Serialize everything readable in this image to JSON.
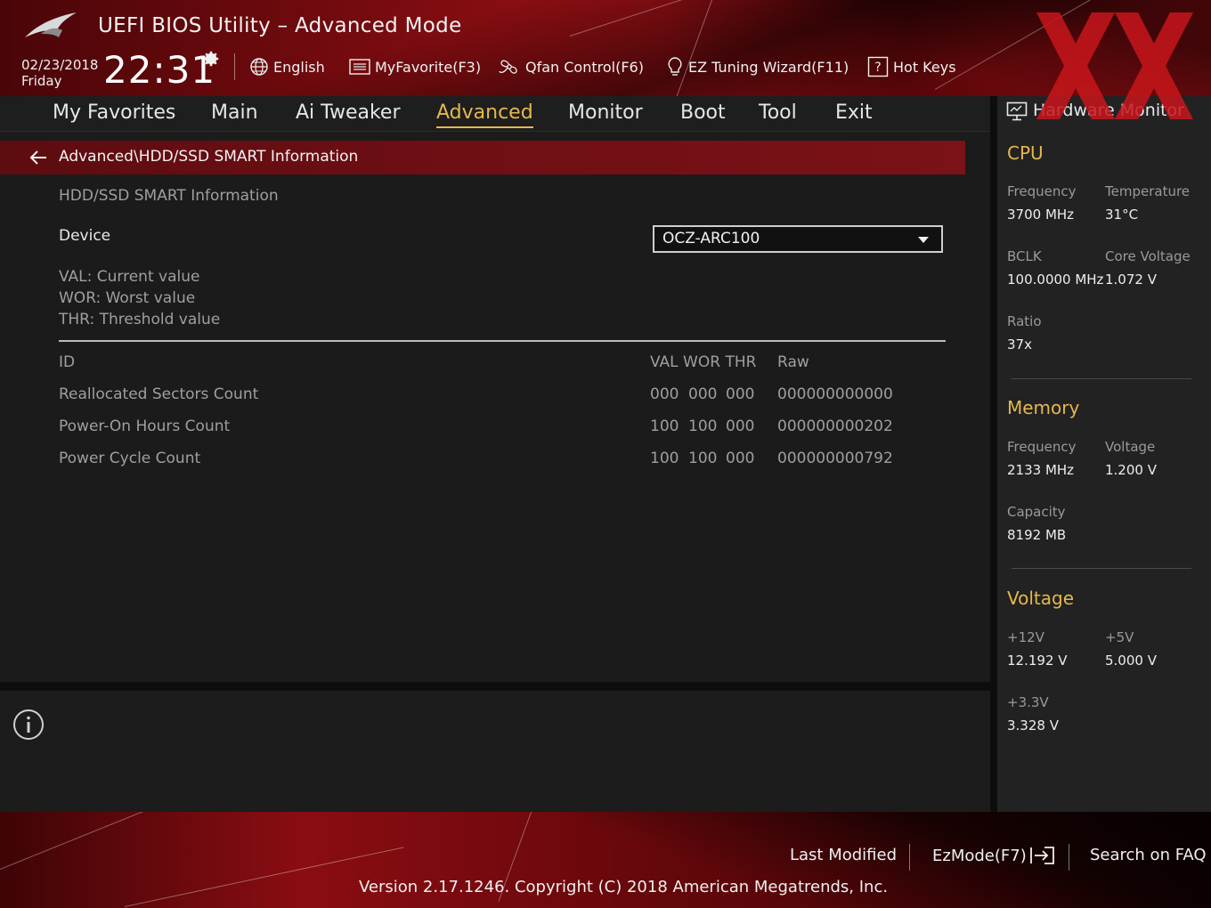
{
  "header": {
    "title": "UEFI BIOS Utility – Advanced Mode",
    "date": "02/23/2018",
    "day": "Friday",
    "time": "22:31",
    "toolbar": {
      "language": "English",
      "myfavorite": "MyFavorite(F3)",
      "qfan": "Qfan Control(F6)",
      "ez_tuning": "EZ Tuning Wizard(F11)",
      "hot_keys": "Hot Keys"
    }
  },
  "nav": {
    "tabs": [
      "My Favorites",
      "Main",
      "Ai Tweaker",
      "Advanced",
      "Monitor",
      "Boot",
      "Tool",
      "Exit"
    ],
    "active": "Advanced"
  },
  "main": {
    "breadcrumb": "Advanced\\HDD/SSD SMART Information",
    "section_heading": "HDD/SSD SMART Information",
    "device_label": "Device",
    "device_value": "OCZ-ARC100",
    "legend": [
      "VAL:  Current value",
      "WOR: Worst value",
      "THR:  Threshold value"
    ],
    "table": {
      "headers": {
        "id": "ID",
        "val_wor_thr": "VAL WOR THR",
        "raw": "Raw"
      },
      "rows": [
        {
          "id": "Reallocated Sectors Count",
          "val": "000",
          "wor": "000",
          "thr": "000",
          "raw": "000000000000"
        },
        {
          "id": "Power-On Hours Count",
          "val": "100",
          "wor": "100",
          "thr": "000",
          "raw": "000000000202"
        },
        {
          "id": "Power Cycle Count",
          "val": "100",
          "wor": "100",
          "thr": "000",
          "raw": "000000000792"
        }
      ]
    }
  },
  "hardware_monitor": {
    "title": "Hardware Monitor",
    "cpu": {
      "heading": "CPU",
      "frequency_label": "Frequency",
      "frequency": "3700 MHz",
      "temperature_label": "Temperature",
      "temperature": "31°C",
      "bclk_label": "BCLK",
      "bclk": "100.0000 MHz",
      "core_voltage_label": "Core Voltage",
      "core_voltage": "1.072 V",
      "ratio_label": "Ratio",
      "ratio": "37x"
    },
    "memory": {
      "heading": "Memory",
      "frequency_label": "Frequency",
      "frequency": "2133 MHz",
      "voltage_label": "Voltage",
      "voltage": "1.200 V",
      "capacity_label": "Capacity",
      "capacity": "8192 MB"
    },
    "voltage": {
      "heading": "Voltage",
      "v12_label": "+12V",
      "v12": "12.192 V",
      "v5_label": "+5V",
      "v5": "5.000 V",
      "v33_label": "+3.3V",
      "v33": "3.328 V"
    }
  },
  "footer": {
    "last_modified": "Last Modified",
    "ezmode": "EzMode(F7)",
    "search_faq": "Search on FAQ",
    "copyright": "Version 2.17.1246. Copyright (C) 2018 American Megatrends, Inc."
  },
  "colors": {
    "accent": "#e5b84b",
    "header_red": "#9a1015",
    "breadcrumb_red": "#6f0f14",
    "background": "#1b1b1b"
  },
  "icons": [
    "rog-logo",
    "gear-icon",
    "globe-icon",
    "myfavorite-icon",
    "fan-icon",
    "bulb-icon",
    "hotkeys-icon",
    "back-arrow-icon",
    "dropdown-caret-icon",
    "info-icon",
    "monitor-icon",
    "exit-arrow-icon"
  ]
}
